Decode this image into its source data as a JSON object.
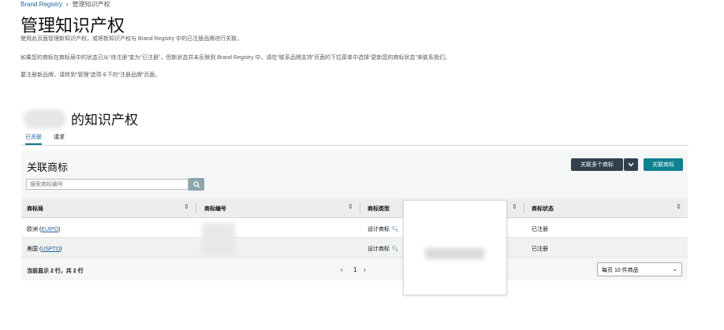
{
  "breadcrumb": {
    "root": "Brand Registry",
    "separator": "›",
    "current": "管理知识产权"
  },
  "page_title": "管理知识产权",
  "descriptions": [
    "使用此页面管理新知识产权，或将新知识产权与 Brand Registry 中的已注册品牌进行关联。",
    "如果您的商标在商标局中的状态已从“待注册”变为“已注册”，但新状态并未反映到 Brand Registry 中，请在“联系品牌支持”页面的下拉菜单中选择“更新您的商标状态”来联系我们。",
    "要注册新品牌，请转到“管理”选项卡下的“注册品牌”页面。"
  ],
  "section_title": "的知识产权",
  "tabs": [
    {
      "label": "已关联",
      "active": true
    },
    {
      "label": "请求",
      "active": false
    }
  ],
  "panel": {
    "title": "关联商标",
    "search_placeholder": "搜索商标编号",
    "link_multiple_label": "关联多个商标",
    "link_label": "关联商标"
  },
  "table": {
    "columns": [
      "商标局",
      "商标编号",
      "商标类型",
      "商标状态"
    ],
    "rows": [
      {
        "office": "欧洲",
        "office_code": "EUIPO",
        "type": "设计商标",
        "status": "已注册"
      },
      {
        "office": "美国",
        "office_code": "USPTO",
        "type": "设计商标",
        "status": "已注册"
      }
    ]
  },
  "footer": {
    "showing": "当前显示 2 行，共 2 行",
    "prev": "‹",
    "page": "1",
    "next": "›",
    "per_page": "每页 10 件商品"
  },
  "colors": {
    "link": "#2162a1",
    "teal": "#0f818f",
    "dark": "#31404d"
  },
  "icons": {
    "search": "search-icon",
    "sort": "sort-icon",
    "chevron": "chevron-down-icon",
    "magnifier": "magnifier-icon"
  }
}
